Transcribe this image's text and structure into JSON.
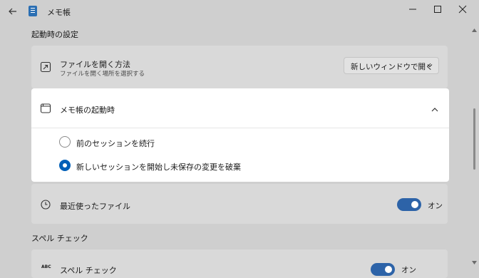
{
  "titlebar": {
    "title": "メモ帳"
  },
  "sections": {
    "startup": "起動時の設定",
    "spell": "スペル チェック"
  },
  "open_file": {
    "title": "ファイルを開く方法",
    "subtitle": "ファイルを開く場所を選択する",
    "dropdown_value": "新しいウィンドウで開く"
  },
  "notepad_startup": {
    "title": "メモ帳の起動時",
    "options": [
      {
        "label": "前のセッションを続行",
        "selected": false
      },
      {
        "label": "新しいセッションを開始し未保存の変更を破棄",
        "selected": true
      }
    ]
  },
  "recent_files": {
    "title": "最近使ったファイル",
    "toggle_label": "オン",
    "on": true
  },
  "spell_check": {
    "title": "スペル チェック",
    "toggle_label": "オン",
    "on": true,
    "icon_text": "ABC"
  },
  "colors": {
    "accent": "#005fb8",
    "toggle": "#2d63a8",
    "background": "#cfcfcf",
    "card": "#d9d9d9"
  }
}
